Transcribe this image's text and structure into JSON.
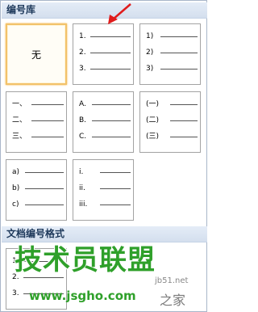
{
  "library": {
    "header": "编号库",
    "none_label": "无",
    "tiles": [
      {
        "labels": [
          "1.",
          "2.",
          "3."
        ]
      },
      {
        "labels": [
          "1)",
          "2)",
          "3)"
        ]
      },
      {
        "labels": [
          "一、",
          "二、",
          "三、"
        ]
      },
      {
        "labels": [
          "A.",
          "B.",
          "C."
        ]
      },
      {
        "labels": [
          "(一)",
          "(二)",
          "(三)"
        ]
      },
      {
        "labels": [
          "a)",
          "b)",
          "c)"
        ]
      },
      {
        "labels": [
          "i.",
          "ii.",
          "iii."
        ]
      }
    ]
  },
  "document_formats": {
    "header": "文档编号格式",
    "tile": {
      "labels": [
        "1.",
        "2.",
        "3."
      ]
    }
  },
  "watermark": {
    "text": "技术员联盟",
    "site": "www.jsgho.com",
    "side_text": "jb51.net",
    "mark": "之家"
  },
  "colors": {
    "selected_border": "#f2c26a",
    "header_bg": "#d4dfee",
    "arrow": "#e01b1b",
    "watermark": "#2fa02a"
  }
}
